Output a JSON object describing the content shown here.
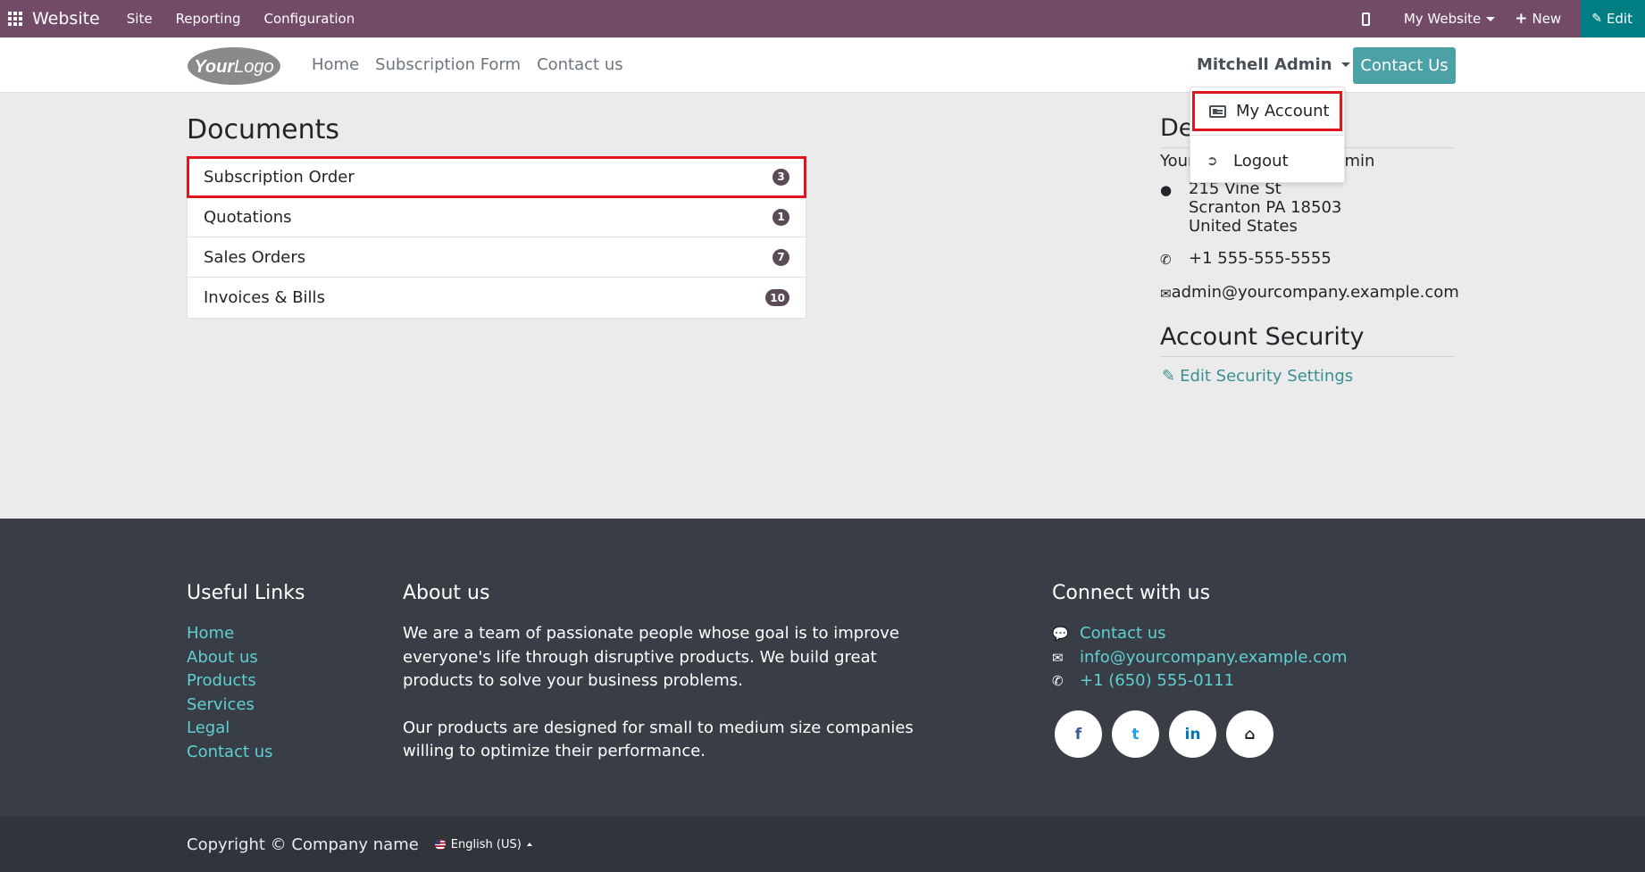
{
  "admin_bar": {
    "brand": "Website",
    "menu": [
      "Site",
      "Reporting",
      "Configuration"
    ],
    "website_selector": "My Website",
    "new_label": "New",
    "edit_label": "Edit"
  },
  "header": {
    "logo_text": "YourLogo",
    "nav": [
      "Home",
      "Subscription Form",
      "Contact us"
    ],
    "user_name": "Mitchell Admin",
    "contact_button": "Contact Us"
  },
  "dropdown": {
    "items": [
      {
        "label": "My Account",
        "icon": "id-card-icon"
      },
      {
        "label": "Logout",
        "icon": "sign-out-icon"
      }
    ]
  },
  "documents": {
    "title": "Documents",
    "items": [
      {
        "label": "Subscription Order",
        "count": "3"
      },
      {
        "label": "Quotations",
        "count": "1"
      },
      {
        "label": "Sales Orders",
        "count": "7"
      },
      {
        "label": "Invoices & Bills",
        "count": "10"
      }
    ]
  },
  "details": {
    "title_visible": "De",
    "name_left": "Your",
    "name_right": "min",
    "address_lines": [
      "215 Vine St",
      "Scranton PA 18503",
      "United States"
    ],
    "phone": "+1 555-555-5555",
    "email": "admin@yourcompany.example.com"
  },
  "security": {
    "title": "Account Security",
    "link": "Edit Security Settings"
  },
  "footer": {
    "useful_links_title": "Useful Links",
    "useful_links": [
      "Home",
      "About us",
      "Products",
      "Services",
      "Legal",
      "Contact us"
    ],
    "about_title": "About us",
    "about_p1": "We are a team of passionate people whose goal is to improve everyone's life through disruptive products. We build great products to solve your business problems.",
    "about_p2": "Our products are designed for small to medium size companies willing to optimize their performance.",
    "connect_title": "Connect with us",
    "connect": {
      "contact": "Contact us",
      "email": "info@yourcompany.example.com",
      "phone": "+1 (650) 555-0111"
    },
    "socials": {
      "facebook": "f",
      "twitter": "t",
      "linkedin": "in",
      "home": "⌂"
    }
  },
  "copyright": {
    "text": "Copyright © Company name",
    "language": "English (US)"
  }
}
